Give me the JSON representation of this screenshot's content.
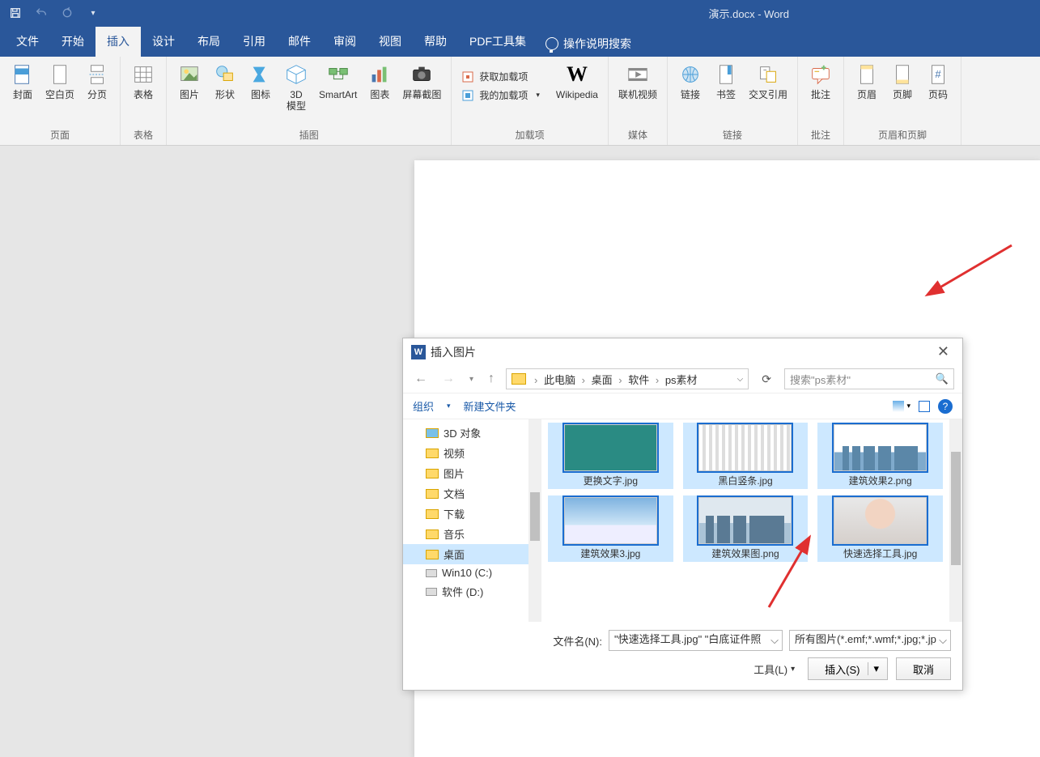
{
  "title": "演示.docx  -  Word",
  "tabs": {
    "file": "文件",
    "home": "开始",
    "insert": "插入",
    "design": "设计",
    "layout": "布局",
    "references": "引用",
    "mailings": "邮件",
    "review": "审阅",
    "view": "视图",
    "help": "帮助",
    "pdf": "PDF工具集",
    "tellme": "操作说明搜索"
  },
  "ribbon": {
    "pages": {
      "cover": "封面",
      "blank": "空白页",
      "break": "分页",
      "group": "页面"
    },
    "tables": {
      "table": "表格",
      "group": "表格"
    },
    "illus": {
      "pictures": "图片",
      "shapes": "形状",
      "icons": "图标",
      "model3d": "3D\n模型",
      "smartart": "SmartArt",
      "chart": "图表",
      "screenshot": "屏幕截图",
      "group": "插图"
    },
    "addins": {
      "get": "获取加载项",
      "my": "我的加载项",
      "wiki": "Wikipedia",
      "group": "加载项"
    },
    "media": {
      "video": "联机视频",
      "group": "媒体"
    },
    "links": {
      "link": "链接",
      "bookmark": "书签",
      "xref": "交叉引用",
      "group": "链接"
    },
    "comments": {
      "comment": "批注",
      "group": "批注"
    },
    "hf": {
      "header": "页眉",
      "footer": "页脚",
      "pagenum": "页码",
      "group": "页眉和页脚"
    }
  },
  "dialog": {
    "title": "插入图片",
    "crumbs": [
      "此电脑",
      "桌面",
      "软件",
      "ps素材"
    ],
    "search_placeholder": "搜索\"ps素材\"",
    "organize": "组织",
    "newfolder": "新建文件夹",
    "tree": {
      "objects3d": "3D 对象",
      "video": "视频",
      "pictures": "图片",
      "documents": "文档",
      "downloads": "下载",
      "music": "音乐",
      "desktop": "桌面",
      "win10": "Win10 (C:)",
      "soft": "软件 (D:)"
    },
    "files": [
      {
        "name": "更换文字.jpg"
      },
      {
        "name": "黑白竖条.jpg"
      },
      {
        "name": "建筑效果2.png"
      },
      {
        "name": "建筑效果3.jpg"
      },
      {
        "name": "建筑效果图.png"
      },
      {
        "name": "快速选择工具.jpg"
      }
    ],
    "filename_label": "文件名(N):",
    "filename_value": "\"快速选择工具.jpg\" \"白底证件照",
    "filter": "所有图片(*.emf;*.wmf;*.jpg;*.jp",
    "tools": "工具(L)",
    "insert": "插入(S)",
    "cancel": "取消"
  }
}
